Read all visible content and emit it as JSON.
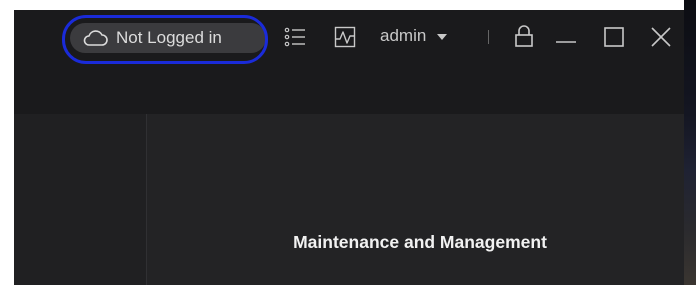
{
  "toolbar": {
    "login_status": "Not Logged in",
    "login_icon": "cloud-icon",
    "task_list_icon": "list-icon",
    "monitor_icon": "activity-icon",
    "user_name": "admin",
    "user_dropdown_icon": "caret-down-icon",
    "lock_icon": "lock-icon",
    "minimize_icon": "minimize-icon",
    "maximize_icon": "maximize-icon",
    "close_icon": "close-icon"
  },
  "main": {
    "section_title": "Maintenance and Management"
  },
  "colors": {
    "titlebar_bg": "#1a1a1c",
    "content_bg": "#232325",
    "pill_bg": "#3b3b3e",
    "annotation": "#1a2bd9",
    "title_text": "#f2f2f2"
  }
}
